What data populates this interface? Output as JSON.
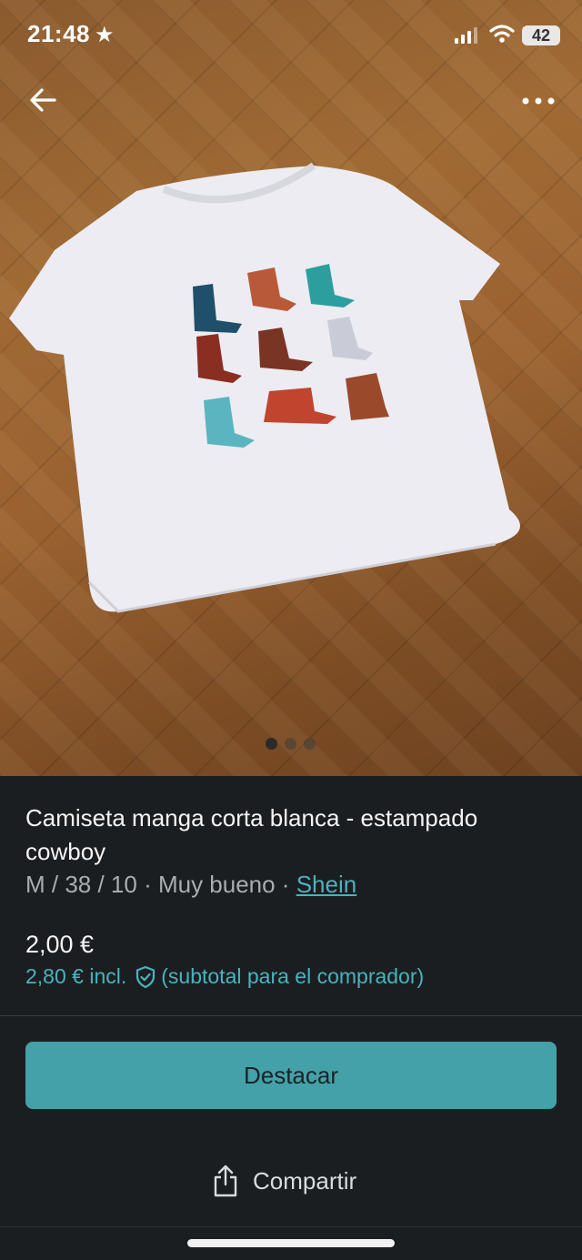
{
  "status_bar": {
    "time": "21:48",
    "battery": "42"
  },
  "product": {
    "title": "Camiseta manga corta blanca - estampado cowboy",
    "meta_prefix": "M / 38 / 10 · Muy bueno · ",
    "brand": "Shein",
    "price": "2,00 €",
    "price_incl": "2,80 € incl.",
    "price_incl_note": "(subtotal para el comprador)"
  },
  "gallery": {
    "image_count": 3,
    "active_index": 0
  },
  "actions": {
    "highlight_label": "Destacar",
    "share_label": "Compartir"
  },
  "colors": {
    "accent": "#44a1a9",
    "link": "#4ab3bf",
    "background": "#1b1e20"
  }
}
